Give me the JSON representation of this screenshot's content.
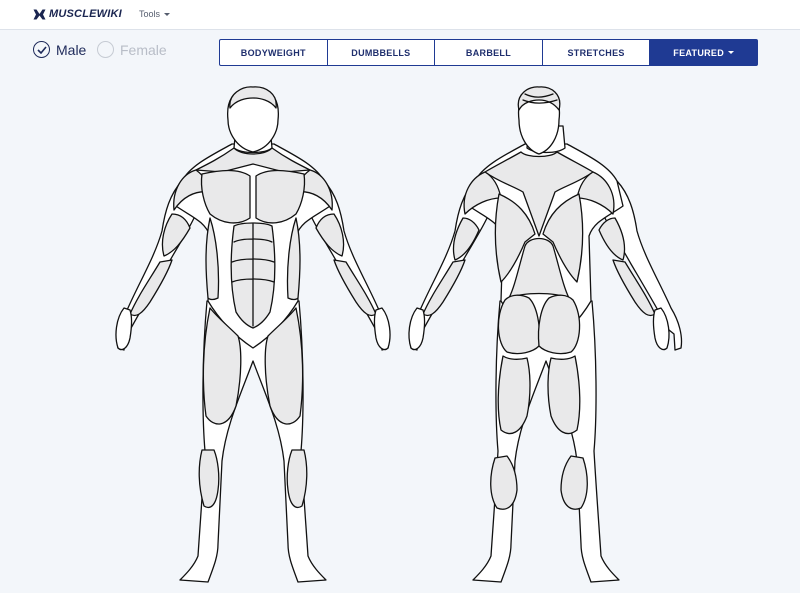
{
  "brand": {
    "name": "MUSCLEWIKI"
  },
  "nav": {
    "tools_label": "Tools"
  },
  "gender": {
    "male_label": "Male",
    "female_label": "Female",
    "selected": "Male"
  },
  "tabs": [
    {
      "label": "BODYWEIGHT",
      "active": false
    },
    {
      "label": "DUMBBELLS",
      "active": false
    },
    {
      "label": "BARBELL",
      "active": false
    },
    {
      "label": "STRETCHES",
      "active": false
    },
    {
      "label": "FEATURED",
      "active": true
    }
  ],
  "colors": {
    "accent": "#1f3a93",
    "muscle_fill": "#e9e9ea",
    "background": "#f3f6fa"
  },
  "icons": {
    "logo": "muscle-logo-icon",
    "check": "check-icon",
    "dropdown": "chevron-down-icon"
  }
}
